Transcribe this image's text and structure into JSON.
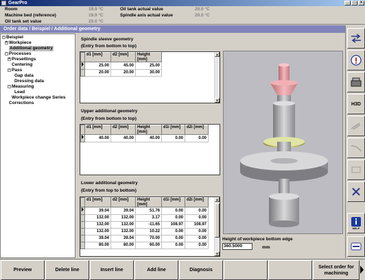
{
  "window": {
    "title": "GearPro"
  },
  "status": {
    "room_label": "Room",
    "room_value": "19.9 °C",
    "bed_label": "Machine bed (reference)",
    "bed_value": "19.9 °C",
    "oiltankset_label": "Oil tank set value",
    "oiltankset_value": "20.0 °C",
    "oiltankact_label": "Oil tank actual value",
    "oiltankact_value": "20.0 °C",
    "spindle_label": "Spindle axis actual value",
    "spindle_value": "20.0 °C"
  },
  "header": {
    "breadcrumb": "Order data / Beispiel / Additional geometry"
  },
  "tree": {
    "items": [
      "Beispiel",
      "Workpiece",
      "Additional geometry",
      "Processes",
      "Presettings",
      "Centering",
      "Pass",
      "Gap data",
      "Dressing data",
      "Measuring",
      "Lead",
      "Workpiece change Series",
      "Corrections"
    ]
  },
  "spindle": {
    "title": "Spindle sleeve geometry",
    "subtitle": "(Entry from bottom to top)",
    "columns": [
      "d1 [mm]",
      "d2 [mm]",
      "Height [mm]"
    ],
    "rows": [
      [
        "25.00",
        "45.00",
        "25.00"
      ],
      [
        "20.00",
        "20.00",
        "30.00"
      ]
    ]
  },
  "upper": {
    "title": "Upper additional geometry",
    "subtitle": "(Entry from bottom to top)",
    "columns": [
      "d1 [mm]",
      "d2 [mm]",
      "Height [mm]",
      "d1i [mm]",
      "d2i [mm]"
    ],
    "rows": [
      [
        "40.00",
        "40.00",
        "40.00",
        "0.00",
        "0.00"
      ]
    ]
  },
  "lower": {
    "title": "Lower additional geometry",
    "subtitle": "(Entry from top to bottom)",
    "columns": [
      "d1 [mm]",
      "d2 [mm]",
      "Height [mm]",
      "d1i [mm]",
      "d2i [mm]"
    ],
    "rows": [
      [
        "39.04",
        "39.04",
        "51.76",
        "0.00",
        "0.00"
      ],
      [
        "132.00",
        "132.00",
        "3.17",
        "0.00",
        "0.00"
      ],
      [
        "132.00",
        "132.00",
        "-11.65",
        "108.97",
        "108.97"
      ],
      [
        "132.00",
        "132.00",
        "10.22",
        "0.00",
        "0.00"
      ],
      [
        "39.04",
        "39.04",
        "70.00",
        "0.00",
        "0.00"
      ],
      [
        "80.00",
        "80.00",
        "60.00",
        "0.00",
        "0.00"
      ]
    ]
  },
  "bottom_edge": {
    "label": "Height of workpiece bottom edge",
    "value": "360.5000",
    "unit": "mm"
  },
  "sidebar_icons": [
    "arrows-swap-icon",
    "info-circle-icon",
    "machine-icon",
    "h3d-icon",
    "ruler-icon",
    "curve-icon",
    "tool-icon",
    "close-x-icon",
    "help-icon",
    "keyboard-icon"
  ],
  "sidebar_text": {
    "h3d": "H3D",
    "help": "HELP"
  },
  "footer": {
    "preview": "Preview",
    "delete_line": "Delete line",
    "insert_line": "Insert line",
    "add_line": "Add line",
    "diagnosis": "Diagnosis",
    "select_order": "Select order for machining"
  },
  "colors": {
    "header_bg": "#8184b9",
    "title_bg": "#0a246a",
    "view_bg": "#bcbcc2"
  }
}
